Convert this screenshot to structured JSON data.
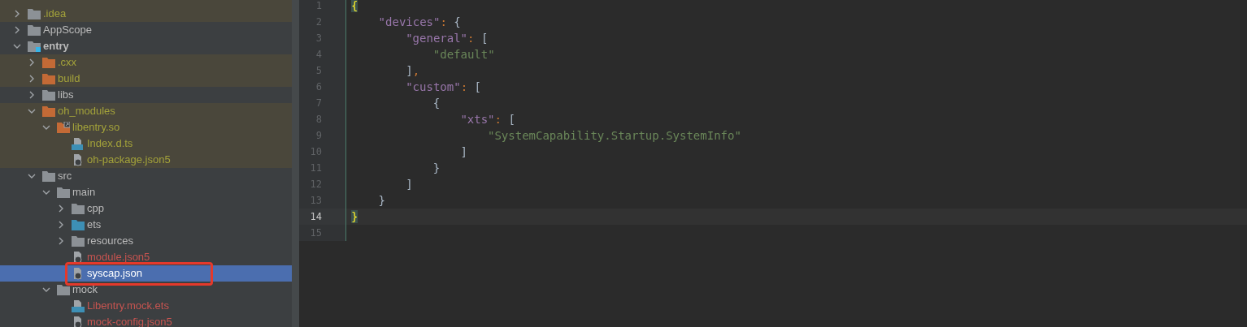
{
  "project_tree": {
    "items": [
      {
        "name": ".idea",
        "kind": "folder",
        "ignored": true,
        "new": false,
        "expanded": false,
        "selected": false
      },
      {
        "name": "AppScope",
        "kind": "folder",
        "ignored": false,
        "new": false,
        "expanded": false,
        "selected": false
      },
      {
        "name": "entry",
        "kind": "module",
        "ignored": false,
        "new": false,
        "expanded": true,
        "selected": false,
        "children": [
          {
            "name": ".cxx",
            "kind": "excluded_folder",
            "ignored": true,
            "new": false,
            "expanded": false,
            "selected": false
          },
          {
            "name": "build",
            "kind": "excluded_folder",
            "ignored": true,
            "new": false,
            "expanded": false,
            "selected": false
          },
          {
            "name": "libs",
            "kind": "folder",
            "ignored": false,
            "new": false,
            "expanded": false,
            "selected": false
          },
          {
            "name": "oh_modules",
            "kind": "excluded_folder",
            "ignored": true,
            "new": false,
            "expanded": true,
            "selected": false,
            "children": [
              {
                "name": "libentry.so",
                "kind": "linked_folder",
                "ignored": true,
                "new": false,
                "expanded": true,
                "selected": false,
                "children": [
                  {
                    "name": "Index.d.ts",
                    "kind": "ts_file",
                    "ignored": true,
                    "new": false,
                    "selected": false
                  },
                  {
                    "name": "oh-package.json5",
                    "kind": "json_file",
                    "ignored": true,
                    "new": false,
                    "selected": false
                  }
                ]
              }
            ]
          },
          {
            "name": "src",
            "kind": "folder",
            "ignored": false,
            "new": false,
            "expanded": true,
            "selected": false,
            "children": [
              {
                "name": "main",
                "kind": "folder",
                "ignored": false,
                "new": false,
                "expanded": true,
                "selected": false,
                "children": [
                  {
                    "name": "cpp",
                    "kind": "folder",
                    "ignored": false,
                    "new": false,
                    "expanded": false,
                    "selected": false
                  },
                  {
                    "name": "ets",
                    "kind": "source_folder",
                    "ignored": false,
                    "new": false,
                    "expanded": false,
                    "selected": false
                  },
                  {
                    "name": "resources",
                    "kind": "folder",
                    "ignored": false,
                    "new": false,
                    "expanded": false,
                    "selected": false
                  },
                  {
                    "name": "module.json5",
                    "kind": "json_file",
                    "ignored": false,
                    "new": true,
                    "selected": false
                  },
                  {
                    "name": "syscap.json",
                    "kind": "json_file",
                    "selected": true,
                    "annotated": true
                  }
                ]
              },
              {
                "name": "mock",
                "kind": "folder",
                "ignored": false,
                "new": false,
                "expanded": true,
                "selected": false,
                "children": [
                  {
                    "name": "Libentry.mock.ets",
                    "kind": "ets_file",
                    "ignored": false,
                    "new": true,
                    "selected": false
                  },
                  {
                    "name": "mock-config.json5",
                    "kind": "json_file",
                    "ignored": false,
                    "new": true,
                    "selected": false
                  }
                ]
              }
            ]
          }
        ]
      }
    ]
  },
  "editor": {
    "lines": [
      {
        "number": "1",
        "current": false,
        "tokens": [
          {
            "kind": "brace_match",
            "text": "{"
          }
        ],
        "children": [
          {
            "number": "2",
            "current": false,
            "tokens": [
              {
                "kind": "key",
                "text": "\"devices\""
              },
              {
                "kind": "sep",
                "text": ": "
              },
              {
                "kind": "punct",
                "text": "{"
              }
            ],
            "children": [
              {
                "number": "3",
                "current": false,
                "tokens": [
                  {
                    "kind": "key",
                    "text": "\"general\""
                  },
                  {
                    "kind": "sep",
                    "text": ": "
                  },
                  {
                    "kind": "punct",
                    "text": "["
                  }
                ],
                "children": [
                  {
                    "number": "4",
                    "current": false,
                    "tokens": [
                      {
                        "kind": "string",
                        "text": "\"default\""
                      }
                    ]
                  }
                ]
              },
              {
                "number": "5",
                "current": false,
                "tokens": [
                  {
                    "kind": "punct",
                    "text": "]"
                  },
                  {
                    "kind": "sep",
                    "text": ","
                  }
                ]
              },
              {
                "number": "6",
                "current": false,
                "tokens": [
                  {
                    "kind": "key",
                    "text": "\"custom\""
                  },
                  {
                    "kind": "sep",
                    "text": ": "
                  },
                  {
                    "kind": "punct",
                    "text": "["
                  }
                ],
                "children": [
                  {
                    "number": "7",
                    "current": false,
                    "tokens": [
                      {
                        "kind": "punct",
                        "text": "{"
                      }
                    ],
                    "children": [
                      {
                        "number": "8",
                        "current": false,
                        "tokens": [
                          {
                            "kind": "key",
                            "text": "\"xts\""
                          },
                          {
                            "kind": "sep",
                            "text": ": "
                          },
                          {
                            "kind": "punct",
                            "text": "["
                          }
                        ],
                        "children": [
                          {
                            "number": "9",
                            "current": false,
                            "tokens": [
                              {
                                "kind": "string",
                                "text": "\"SystemCapability.Startup.SystemInfo\""
                              }
                            ]
                          }
                        ]
                      },
                      {
                        "number": "10",
                        "current": false,
                        "tokens": [
                          {
                            "kind": "punct",
                            "text": "]"
                          }
                        ]
                      }
                    ]
                  },
                  {
                    "number": "11",
                    "current": false,
                    "tokens": [
                      {
                        "kind": "punct",
                        "text": "}"
                      }
                    ]
                  }
                ]
              },
              {
                "number": "12",
                "current": false,
                "tokens": [
                  {
                    "kind": "punct",
                    "text": "]"
                  }
                ]
              }
            ]
          },
          {
            "number": "13",
            "current": false,
            "tokens": [
              {
                "kind": "punct",
                "text": "}"
              }
            ]
          }
        ]
      },
      {
        "number": "14",
        "current": true,
        "tokens": [
          {
            "kind": "brace_match",
            "text": "}"
          }
        ]
      },
      {
        "number": "15",
        "current": false
      }
    ]
  }
}
